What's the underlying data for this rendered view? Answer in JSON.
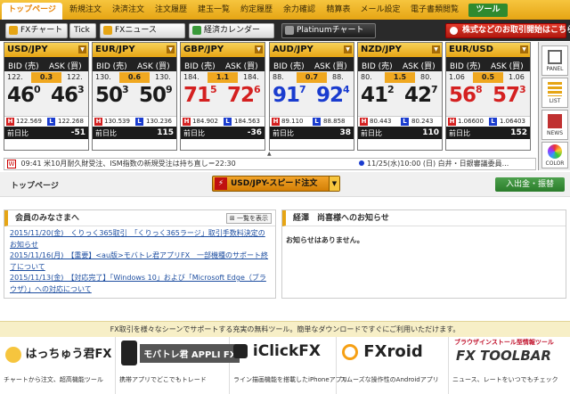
{
  "nav": {
    "tabs": [
      "トップページ",
      "新規注文",
      "決済注文",
      "注文履歴",
      "建玉一覧",
      "約定履歴",
      "余力確認",
      "精算表",
      "メール設定",
      "電子書類閲覧"
    ],
    "tools_label": "ツール"
  },
  "toolbar": {
    "fx_chart": "FXチャート",
    "tick": "Tick",
    "fx_news": "FXニュース",
    "calendar": "経済カレンダー",
    "platinum": "Platinumチャート",
    "stock_promo": "株式などのお取引開始はこちら"
  },
  "labels": {
    "bid": "BID (売)",
    "ask": "ASK (買)",
    "diff": "前日比",
    "h": "H",
    "l": "L"
  },
  "rates": [
    {
      "pair": "USD/JPY",
      "bid_small": "122.",
      "bid_big": "46",
      "bid_sup": "0",
      "ask_small": "122.",
      "ask_big": "46",
      "ask_sup": "3",
      "spread": "0.3",
      "high": "122.569",
      "low": "122.268",
      "diff": "-51",
      "bid_color": "#1a1a1a",
      "ask_color": "#1a1a1a"
    },
    {
      "pair": "EUR/JPY",
      "bid_small": "130.",
      "bid_big": "50",
      "bid_sup": "3",
      "ask_small": "130.",
      "ask_big": "50",
      "ask_sup": "9",
      "spread": "0.6",
      "high": "130.539",
      "low": "130.236",
      "diff": "115",
      "bid_color": "#1a1a1a",
      "ask_color": "#1a1a1a"
    },
    {
      "pair": "GBP/JPY",
      "bid_small": "184.",
      "bid_big": "71",
      "bid_sup": "5",
      "ask_small": "184.",
      "ask_big": "72",
      "ask_sup": "6",
      "spread": "1.1",
      "high": "184.902",
      "low": "184.563",
      "diff": "-36",
      "bid_color": "#d42020",
      "ask_color": "#d42020"
    },
    {
      "pair": "AUD/JPY",
      "bid_small": "88.",
      "bid_big": "91",
      "bid_sup": "7",
      "ask_small": "88.",
      "ask_big": "92",
      "ask_sup": "4",
      "spread": "0.7",
      "high": "89.110",
      "low": "88.858",
      "diff": "38",
      "bid_color": "#1a3ccf",
      "ask_color": "#1a3ccf"
    },
    {
      "pair": "NZD/JPY",
      "bid_small": "80.",
      "bid_big": "41",
      "bid_sup": "2",
      "ask_small": "80.",
      "ask_big": "42",
      "ask_sup": "7",
      "spread": "1.5",
      "high": "80.443",
      "low": "80.243",
      "diff": "110",
      "bid_color": "#1a1a1a",
      "ask_color": "#1a1a1a"
    },
    {
      "pair": "EUR/USD",
      "bid_small": "1.06",
      "bid_big": "56",
      "bid_sup": "8",
      "ask_small": "1.06",
      "ask_big": "57",
      "ask_sup": "3",
      "spread": "0.5",
      "high": "1.06600",
      "low": "1.06403",
      "diff": "152",
      "bid_color": "#d42020",
      "ask_color": "#d42020"
    }
  ],
  "side": {
    "panel": "PANEL",
    "list": "LIST",
    "news": "NEWS",
    "color": "COLOR"
  },
  "news": {
    "tag": "W",
    "left": "09:41 米10月耐久財受注、ISM指数の新規受注は持ち直し＝22:30",
    "right": "11/25(水)10:00 (日) 白井・日銀審議委員..."
  },
  "page": {
    "title": "トップページ",
    "speed_order": "USD/JPY-スピード注文",
    "deposit": "入出金・振替"
  },
  "notices": {
    "title": "会員のみなさまへ",
    "list_button": "一覧を表示",
    "items": [
      "2015/11/20(金)　くりっく365取引　「くりっく365ラージ」取引手数料決定のお知らせ",
      "2015/11/16(月)　【重要】<au版>モバトレ君アプリFX　一部機種のサポート終了について",
      "2015/11/13(金)　【対応完了】「Windows 10」および「Microsoft Edge（ブラウザ）」への対応について"
    ]
  },
  "personal": {
    "title": "経澤　尚喜様へのお知らせ",
    "empty": "お知らせはありません。"
  },
  "tools_banner": "FX取引を様々なシーンでサポートする充実の無料ツール。簡単なダウンロードですぐにご利用いただけます。",
  "tools": [
    {
      "name": "はっちゅう君FX",
      "desc": "チャートから注文、超高機能ツール"
    },
    {
      "name": "モバトレ君 APPLI FX",
      "desc": "携帯アプリでどこでもトレード"
    },
    {
      "name": "iClickFX",
      "desc": "ライン描画機能を搭載したiPhoneアプリ"
    },
    {
      "name": "FXroid",
      "desc": "スムーズな操作性のAndroidアプリ"
    },
    {
      "name": "FX TOOLBAR",
      "tagline": "ブラウザインストール型情報ツール",
      "desc": "ニュース、レートをいつでもチェック"
    }
  ],
  "colors": {
    "accent": "#e6a514",
    "green": "#2f8a2f",
    "red": "#d42020",
    "blue": "#1a3ccf"
  }
}
